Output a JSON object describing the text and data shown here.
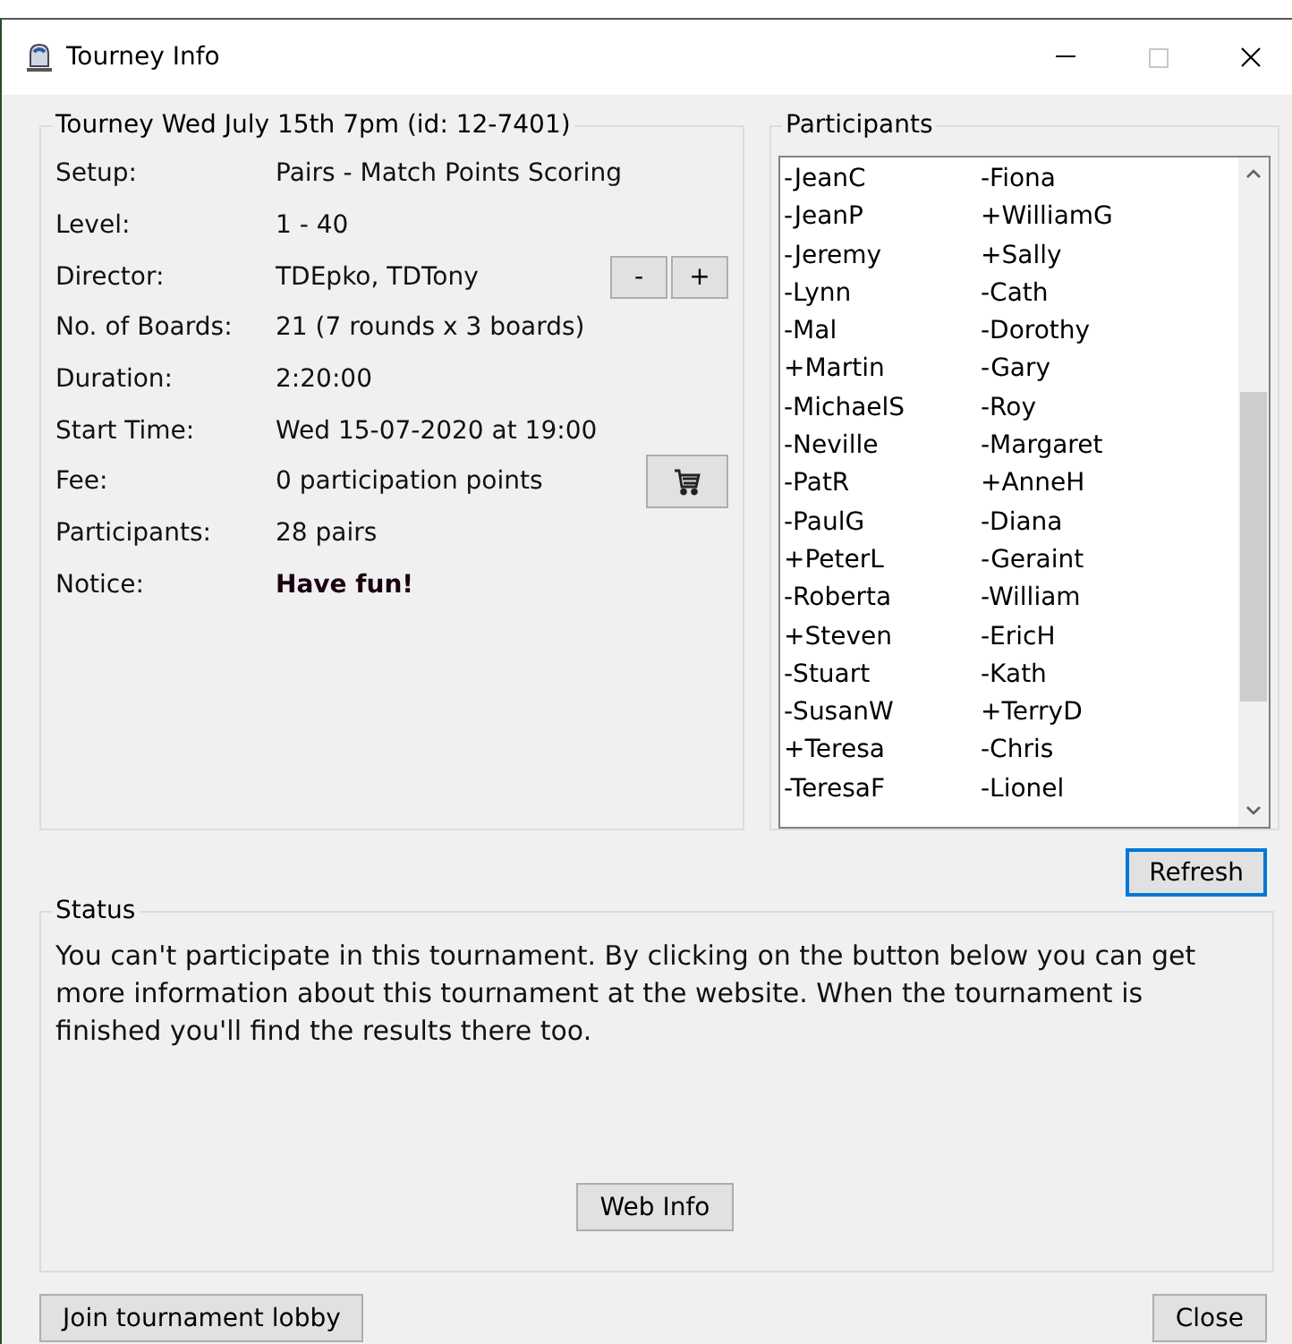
{
  "window": {
    "title": "Tourney Info",
    "maximize_enabled": false
  },
  "tourney": {
    "title": "Tourney Wed July 15th 7pm (id: 12-7401)",
    "rows": [
      {
        "label": "Setup:",
        "value": "Pairs - Match Points Scoring",
        "kind": "text"
      },
      {
        "label": "Level:",
        "value": "1 - 40",
        "kind": "text"
      },
      {
        "label": "Director:",
        "value": "TDEpko, TDTony",
        "kind": "stepper",
        "buttons": [
          "-",
          "+"
        ]
      },
      {
        "label": "No. of Boards:",
        "value": "21 (7 rounds x 3 boards)",
        "kind": "text"
      },
      {
        "label": "Duration:",
        "value": "2:20:00",
        "kind": "text"
      },
      {
        "label": "Start Time:",
        "value": "Wed 15-07-2020 at 19:00",
        "kind": "text"
      },
      {
        "label": "Fee:",
        "value": "0 participation points",
        "kind": "cart"
      },
      {
        "label": "Participants:",
        "value": "28 pairs",
        "kind": "text"
      },
      {
        "label": "Notice:",
        "value": "Have fun!",
        "kind": "notice"
      }
    ]
  },
  "participants": {
    "title": "Participants",
    "rows": [
      [
        "-JeanC",
        "-Fiona"
      ],
      [
        "-JeanP",
        "+WilliamG"
      ],
      [
        "-Jeremy",
        "+Sally"
      ],
      [
        "-Lynn",
        "-Cath"
      ],
      [
        "-Mal",
        "-Dorothy"
      ],
      [
        "+Martin",
        "-Gary"
      ],
      [
        "-MichaelS",
        "-Roy"
      ],
      [
        "-Neville",
        "-Margaret"
      ],
      [
        "-PatR",
        "+AnneH"
      ],
      [
        "-PaulG",
        "-Diana"
      ],
      [
        "+PeterL",
        "-Geraint"
      ],
      [
        "-Roberta",
        "-William"
      ],
      [
        "+Steven",
        "-EricH"
      ],
      [
        "-Stuart",
        "-Kath"
      ],
      [
        "-SusanW",
        "+TerryD"
      ],
      [
        "+Teresa",
        "-Chris"
      ],
      [
        "-TeresaF",
        "-Lionel"
      ]
    ]
  },
  "refresh_button": {
    "label": "Refresh",
    "default": true
  },
  "status": {
    "title": "Status",
    "text": "You can't participate in this tournament. By clicking on the button below you can get more information about this tournament at the website. When the tournament is finished you'll find the results there too.",
    "button": {
      "label": "Web Info",
      "default": false
    }
  },
  "footer": [
    {
      "label": "Join tournament lobby",
      "default": false
    },
    {
      "label": "Close",
      "default": false
    }
  ]
}
